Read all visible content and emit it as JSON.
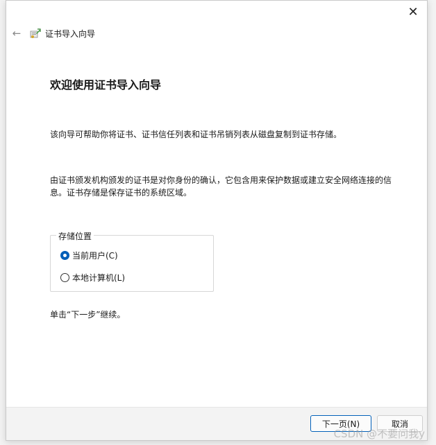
{
  "window": {
    "close_glyph": "✕"
  },
  "header": {
    "back_glyph": "←",
    "title": "证书导入向导"
  },
  "main": {
    "heading": "欢迎使用证书导入向导",
    "intro": "该向导可帮助你将证书、证书信任列表和证书吊销列表从磁盘复制到证书存储。",
    "description": "由证书颁发机构颁发的证书是对你身份的确认，它包含用来保护数据或建立安全网络连接的信息。证书存储是保存证书的系统区域。",
    "store_location": {
      "legend": "存储位置",
      "options": [
        {
          "label": "当前用户(C)",
          "selected": true
        },
        {
          "label": "本地计算机(L)",
          "selected": false
        }
      ]
    },
    "continue_hint": "单击“下一步”继续。"
  },
  "footer": {
    "next_label": "下一页(N)",
    "cancel_label": "取消"
  },
  "watermark": "CSDN @不要问我y",
  "colors": {
    "accent": "#005fb8"
  },
  "icons": {
    "wizard": "certificate-wizard-icon",
    "back": "arrow-left-icon",
    "close": "close-icon"
  }
}
